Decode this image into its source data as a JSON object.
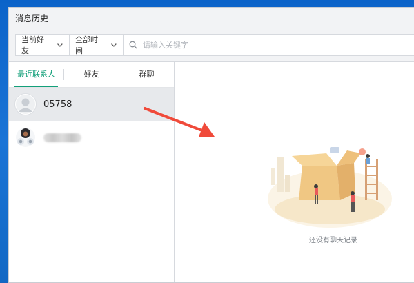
{
  "window": {
    "title": "消息历史"
  },
  "filters": {
    "friend_select": "当前好友",
    "time_select": "全部时间",
    "search_placeholder": "请输入关键字"
  },
  "tabs": [
    {
      "label": "最近联系人",
      "active": true
    },
    {
      "label": "好友",
      "active": false
    },
    {
      "label": "群聊",
      "active": false
    }
  ],
  "contacts": [
    {
      "name": "05758",
      "selected": true,
      "avatar": "default-avatar"
    },
    {
      "name": "",
      "selected": false,
      "avatar": "photo-avatar"
    }
  ],
  "empty_state": {
    "message": "还没有聊天记录",
    "illustration": "box-with-people"
  },
  "colors": {
    "accent": "#13a07a",
    "arrow": "#f04a3a"
  }
}
